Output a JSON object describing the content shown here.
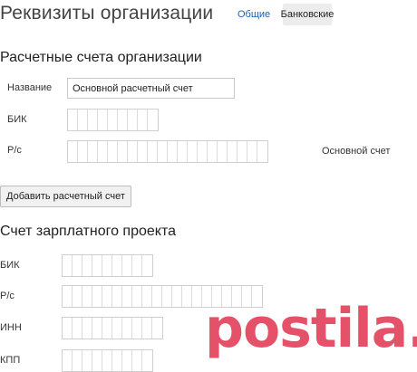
{
  "header": {
    "title": "Реквизиты организации",
    "tabs": [
      {
        "label": "Общие",
        "active": false
      },
      {
        "label": "Банковские",
        "active": true
      }
    ]
  },
  "org_accounts": {
    "heading": "Расчетные счета организации",
    "name_label": "Название",
    "name_value": "Основной расчетный счет",
    "bik_label": "БИК",
    "bik_digits": 9,
    "rs_label": "Р/с",
    "rs_digits": 20,
    "rs_note": "Основной счет",
    "add_button": "Добавить расчетный счет"
  },
  "salary_account": {
    "heading": "Счет зарплатного проекта",
    "bik_label": "БИК",
    "bik_digits": 9,
    "rs_label": "Р/с",
    "rs_digits": 20,
    "inn_label": "ИНН",
    "inn_digits": 10,
    "kpp_label": "КПП",
    "kpp_digits": 9
  },
  "watermark": {
    "text": "postila.ru",
    "color": "#e0334d"
  }
}
